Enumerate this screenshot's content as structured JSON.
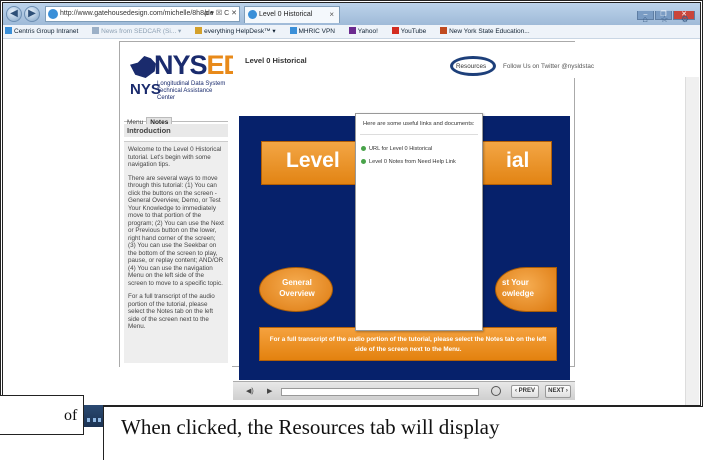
{
  "browser": {
    "address": "http://www.gatehousedesign.com/michelle/8h8/de",
    "address_tools": "ρ ▾ ☒ C ✕",
    "tab_title": "Level 0 Historical",
    "tab_close": "×",
    "window_controls": [
      "–",
      "❐",
      "✕"
    ],
    "sys_icons": "⌂ ☆ ⚙",
    "favorites": [
      {
        "label": "Centris Group Intranet",
        "faded": false,
        "color": "#3a8fd8"
      },
      {
        "label": "News from SEDCAR (Si... ▾",
        "faded": true,
        "color": "#9bb0c7"
      },
      {
        "label": "everything HelpDesk™ ▾",
        "faded": false,
        "color": "#d4a12b"
      },
      {
        "label": "MHRIC VPN",
        "faded": false,
        "color": "#3a8fd8"
      },
      {
        "label": "Yahoo!",
        "faded": false,
        "color": "#6b2a8f"
      },
      {
        "label": "YouTube",
        "faded": false,
        "color": "#d32c20"
      },
      {
        "label": "New York State Education...",
        "faded": false,
        "color": "#c04a1f"
      }
    ]
  },
  "sidebar": {
    "logo_top": "NYS",
    "logo_ed": "ED",
    "logo_nys": "NYS",
    "logo_line1": "Longitudinal Data System",
    "logo_line2": "Technical Assistance Center",
    "tabs": [
      "Menu",
      "Notes"
    ],
    "section_title": "Introduction",
    "notes": [
      "Welcome to the Level 0 Historical tutorial. Let's begin with some navigation tips.",
      "There are several ways to move through this tutorial: (1) You can click the buttons on the screen - General Overview, Demo, or Test Your Knowledge to immediately move to that portion of the program; (2) You can use the Next or Previous button on the lower, right hand corner of the screen; (3) You can use the Seekbar on the bottom of the screen to play, pause, or replay content; AND/OR (4) You can use the navigation Menu on the left side of the screen to move to a specific topic.",
      "For a full transcript of the audio portion of the tutorial, please select the Notes tab on the left side of the screen next to the Menu."
    ]
  },
  "player": {
    "title": "Level 0 Historical",
    "resources_tab": "Resources",
    "follow_text": "Follow Us on Twitter @nysldstac",
    "slide": {
      "banner_left": "Level",
      "banner_right": "ial",
      "oval_left": [
        "General",
        "Overview"
      ],
      "oval_right": [
        "st Your",
        "owledge"
      ],
      "notice": "For a full transcript of the audio portion of the tutorial, please select the Notes tab on the left side of the screen next to the Menu."
    },
    "resources": {
      "intro": "Here are some useful links and documents:",
      "links": [
        "URL for Level 0 Historical",
        "Level 0 Notes from Need Help Link"
      ]
    },
    "controls": {
      "volume": "◀)",
      "play": "▶",
      "prev": "‹ PREV",
      "next": "NEXT ›"
    }
  },
  "captions": {
    "left_fragment": "of",
    "main": "When clicked, the Resources tab will display"
  }
}
